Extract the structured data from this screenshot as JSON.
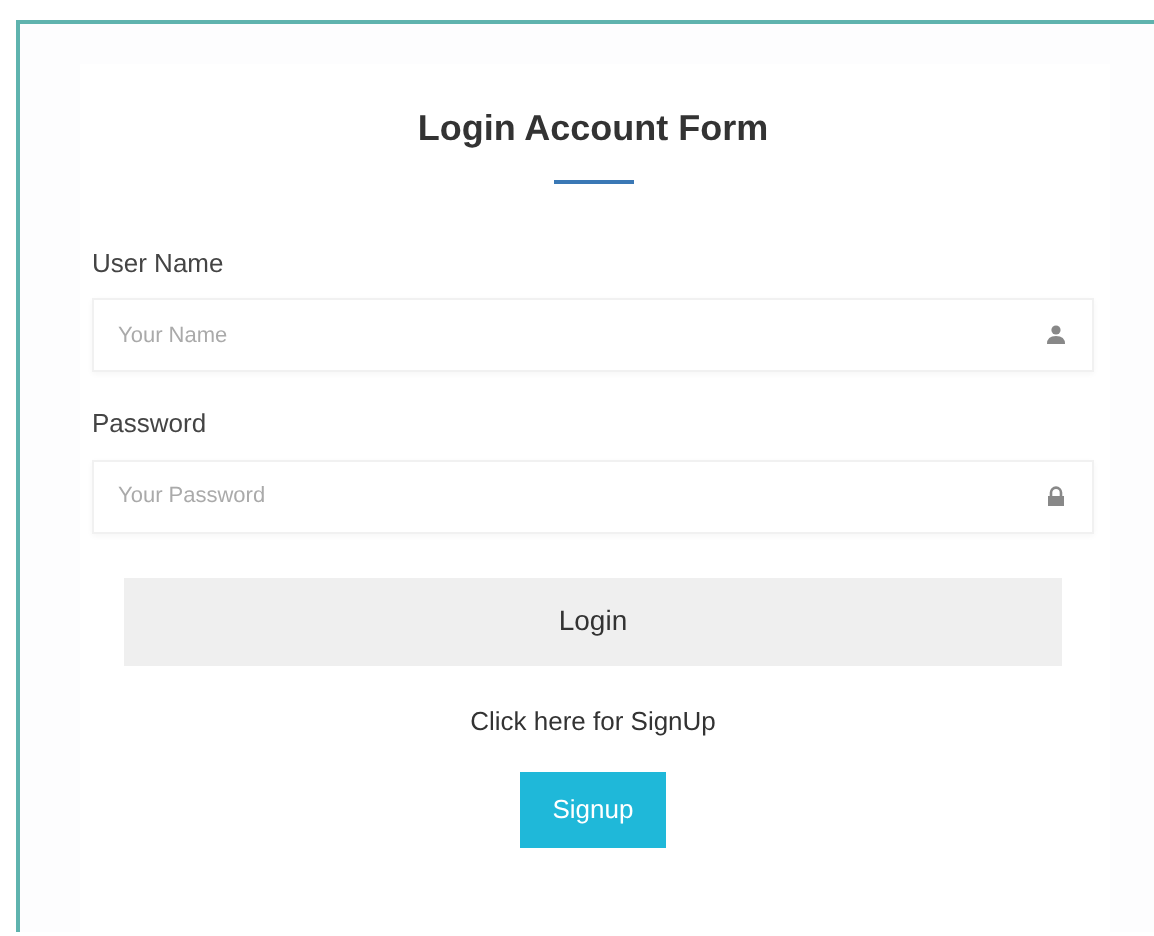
{
  "title": "Login Account Form",
  "fields": [
    {
      "label": "User Name",
      "placeholder": "Your Name",
      "kind": "user"
    },
    {
      "label": "Password",
      "placeholder": "Your Password",
      "kind": "lock"
    }
  ],
  "login_button": "Login",
  "signup_prompt": "Click here for SignUp",
  "signup_button": "Signup"
}
